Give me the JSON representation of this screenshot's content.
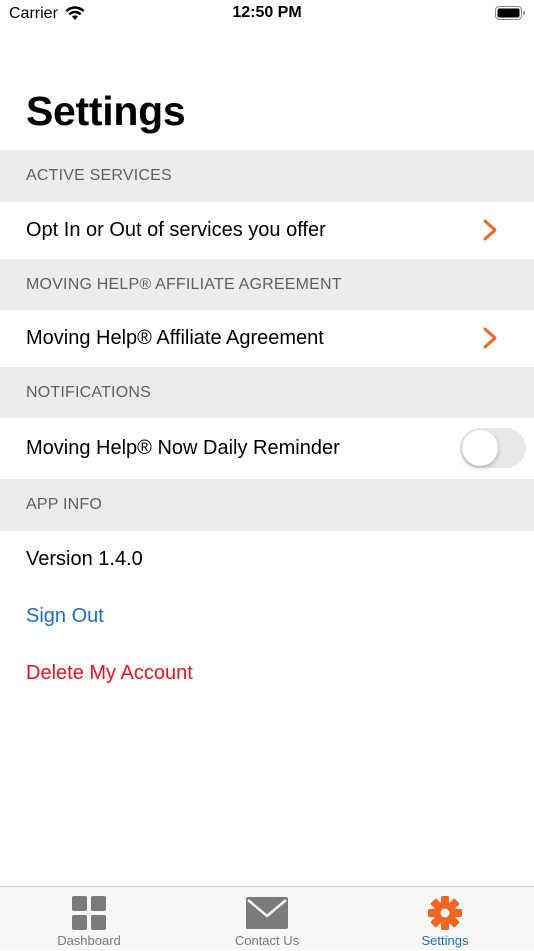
{
  "status_bar": {
    "carrier": "Carrier",
    "time": "12:50 PM"
  },
  "page_title": "Settings",
  "sections": {
    "active_services": {
      "header": "ACTIVE SERVICES",
      "row_label": "Opt In or Out of services you offer"
    },
    "affiliate": {
      "header": "MOVING HELP® AFFILIATE AGREEMENT",
      "row_label": "Moving Help® Affiliate Agreement"
    },
    "notifications": {
      "header": "NOTIFICATIONS",
      "row_label": "Moving Help® Now Daily Reminder",
      "toggle_on": false
    },
    "app_info": {
      "header": "APP INFO",
      "version": "Version 1.4.0",
      "sign_out": "Sign Out",
      "delete_account": "Delete My Account"
    }
  },
  "tab_bar": {
    "tabs": [
      {
        "label": "Dashboard",
        "icon": "dashboard-grid-icon",
        "active": false
      },
      {
        "label": "Contact Us",
        "icon": "envelope-icon",
        "active": false
      },
      {
        "label": "Settings",
        "icon": "gear-icon",
        "active": true
      }
    ]
  },
  "colors": {
    "accent_orange": "#f26522",
    "link_blue": "#1f6fb7",
    "destructive_red": "#e8141f",
    "section_header_bg": "#ececec"
  }
}
